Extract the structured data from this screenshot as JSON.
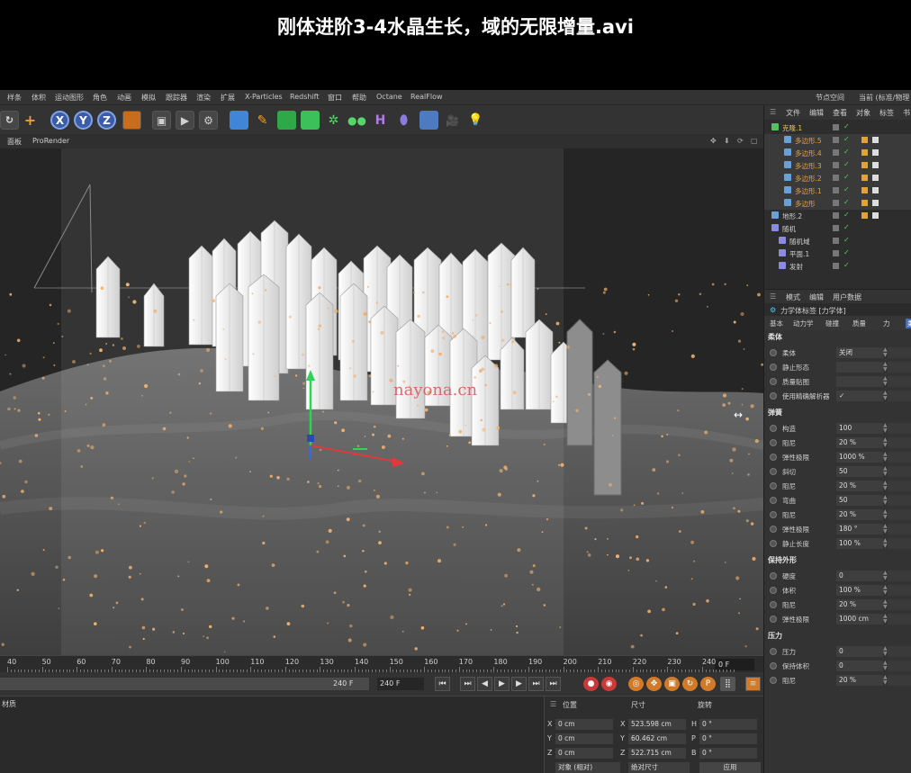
{
  "video_title": "刚体进阶3-4水晶生长，域的无限增量.avi",
  "menubar": {
    "items": [
      "样条",
      "体积",
      "运动图形",
      "角色",
      "动画",
      "模拟",
      "跟踪器",
      "渲染",
      "扩展",
      "X-Particles",
      "Redshift",
      "窗口",
      "帮助",
      "Octane",
      "RealFlow"
    ],
    "right_items": [
      "节点空间",
      "当前 (标准/物理"
    ]
  },
  "toolbar": {
    "x": "X",
    "y": "Y",
    "z": "Z"
  },
  "viewport": {
    "tabs": [
      "面板",
      "ProRender"
    ],
    "watermark": "nayona.cn"
  },
  "timeline": {
    "ticks": [
      "40",
      "50",
      "60",
      "70",
      "80",
      "90",
      "100",
      "110",
      "120",
      "130",
      "140",
      "150",
      "160",
      "170",
      "180",
      "190",
      "200",
      "210",
      "220",
      "230",
      "240"
    ],
    "current_frame": "0 F",
    "range_end": "240 F",
    "end_field": "240 F"
  },
  "material": {
    "tab": "材质"
  },
  "coords": {
    "headers": [
      "位置",
      "尺寸",
      "旋转"
    ],
    "pos": [
      {
        "axis": "X",
        "val": "0 cm"
      },
      {
        "axis": "Y",
        "val": "0 cm"
      },
      {
        "axis": "Z",
        "val": "0 cm"
      }
    ],
    "size": [
      {
        "axis": "X",
        "val": "523.598 cm"
      },
      {
        "axis": "Y",
        "val": "60.462 cm"
      },
      {
        "axis": "Z",
        "val": "522.715 cm"
      }
    ],
    "rot": [
      {
        "axis": "H",
        "val": "0 °"
      },
      {
        "axis": "P",
        "val": "0 °"
      },
      {
        "axis": "B",
        "val": "0 °"
      }
    ],
    "mode_select": "对象 (相对)",
    "size_select": "绝对尺寸",
    "apply": "应用"
  },
  "objects": {
    "tabs": [
      "文件",
      "编辑",
      "查看",
      "对象",
      "标签",
      "书"
    ],
    "rows": [
      {
        "name": "克隆.1",
        "color": "#e8c84a"
      },
      {
        "name": "多边形.5",
        "color": "#e8a040"
      },
      {
        "name": "多边形.4",
        "color": "#e8a040"
      },
      {
        "name": "多边形.3",
        "color": "#e8a040"
      },
      {
        "name": "多边形.2",
        "color": "#e8a040"
      },
      {
        "name": "多边形.1",
        "color": "#e8a040"
      },
      {
        "name": "多边形",
        "color": "#e8a040"
      },
      {
        "name": "地形.2",
        "color": "#cfcfcf"
      },
      {
        "name": "随机",
        "color": "#cfcfcf"
      },
      {
        "name": "随机域",
        "color": "#cfcfcf"
      },
      {
        "name": "平面.1",
        "color": "#cfcfcf"
      },
      {
        "name": "发射",
        "color": "#cfcfcf"
      }
    ]
  },
  "attributes": {
    "tabs": [
      "模式",
      "编辑",
      "用户数据"
    ],
    "title": "力学体标签 [力学体]",
    "subtabs": [
      "基本",
      "动力学",
      "碰撞",
      "质量",
      "力"
    ],
    "sections": {
      "dynamics": "柔体",
      "springs": "弹簧",
      "shape": "保持外形",
      "pressure": "压力"
    },
    "soft": [
      {
        "label": "柔体",
        "val": "关闭"
      },
      {
        "label": "静止形态",
        "val": ""
      },
      {
        "label": "质量贴图",
        "val": ""
      },
      {
        "label": "使用精确解析器",
        "val": "✓"
      }
    ],
    "springs": [
      {
        "label": "构造",
        "val": "100"
      },
      {
        "label": "阻尼",
        "val": "20 %"
      },
      {
        "label": "弹性极限",
        "val": "1000 %"
      },
      {
        "label": "斜切",
        "val": "50"
      },
      {
        "label": "阻尼",
        "val": "20 %"
      },
      {
        "label": "弯曲",
        "val": "50"
      },
      {
        "label": "阻尼",
        "val": "20 %"
      },
      {
        "label": "弹性极限",
        "val": "180 °"
      },
      {
        "label": "静止长度",
        "val": "100 %"
      }
    ],
    "shape": [
      {
        "label": "硬度",
        "val": "0"
      },
      {
        "label": "体积",
        "val": "100 %"
      },
      {
        "label": "阻尼",
        "val": "20 %"
      },
      {
        "label": "弹性极限",
        "val": "1000 cm"
      }
    ],
    "pressure": [
      {
        "label": "压力",
        "val": "0"
      },
      {
        "label": "保持体积",
        "val": "0"
      },
      {
        "label": "阻尼",
        "val": "20 %"
      }
    ]
  },
  "colors": {
    "crystal": "#f2f2f2",
    "ground": "#5a5a5a",
    "sparkle": "#f0b070",
    "watermark": "#d94a4a"
  }
}
